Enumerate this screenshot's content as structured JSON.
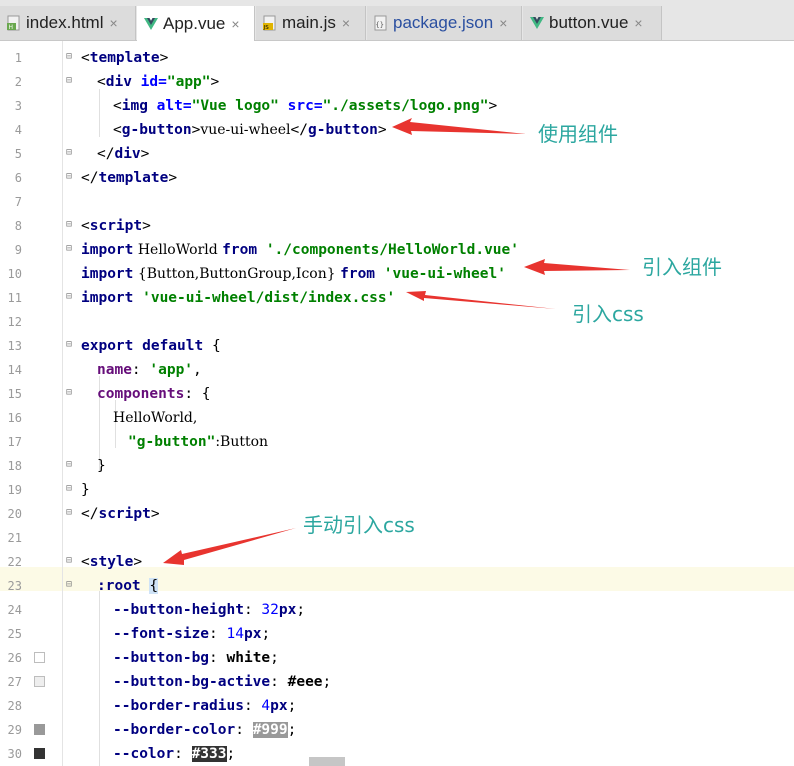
{
  "tabs": [
    {
      "label": "index.html",
      "close": "×",
      "icon": "html-file-icon"
    },
    {
      "label": "App.vue",
      "close": "×",
      "icon": "vue-file-icon"
    },
    {
      "label": "main.js",
      "close": "×",
      "icon": "js-file-icon"
    },
    {
      "label": "package.json",
      "close": "×",
      "icon": "json-file-icon"
    },
    {
      "label": "button.vue",
      "close": "×",
      "icon": "vue-file-icon"
    }
  ],
  "annotations": {
    "use_component": "使用组件",
    "import_component": "引入组件",
    "import_css": "引入css",
    "manual_css": "手动引入css"
  },
  "colors": {
    "accent": "#2ca7a0",
    "arrow": "#e8342f",
    "swatch_white": "#ffffff",
    "swatch_eee": "#eeeeee",
    "swatch_999": "#999999",
    "swatch_333": "#333333"
  },
  "code": {
    "line_numbers": [
      "1",
      "2",
      "3",
      "4",
      "5",
      "6",
      "7",
      "8",
      "9",
      "10",
      "11",
      "12",
      "13",
      "14",
      "15",
      "16",
      "17",
      "18",
      "19",
      "20",
      "21",
      "22",
      "23",
      "24",
      "25",
      "26",
      "27",
      "28",
      "29",
      "30"
    ],
    "l1": {
      "lt": "<",
      "tag": "template",
      "gt": ">"
    },
    "l2": {
      "lt": "<",
      "tag": "div",
      "attr": " id=",
      "val": "\"app\"",
      "gt": ">"
    },
    "l3": {
      "lt": "<",
      "tag": "img",
      "attr1": " alt=",
      "val1": "\"Vue logo\"",
      "attr2": " src=",
      "val2": "\"./assets/logo.png\"",
      "gt": ">"
    },
    "l4": {
      "lt": "<",
      "tag": "g-button",
      "gt": ">",
      "text": "vue-ui-wheel",
      "lt2": "</",
      "tag2": "g-button",
      "gt2": ">"
    },
    "l5": {
      "lt": "</",
      "tag": "div",
      "gt": ">"
    },
    "l6": {
      "lt": "</",
      "tag": "template",
      "gt": ">"
    },
    "l8": {
      "lt": "<",
      "tag": "script",
      "gt": ">"
    },
    "l9": {
      "kw1": "import",
      "name": " HelloWorld ",
      "kw2": "from",
      "str": " './components/HelloWorld.vue'"
    },
    "l10": {
      "kw1": "import",
      "name": " {Button,ButtonGroup,Icon} ",
      "kw2": "from",
      "str": " 'vue-ui-wheel'"
    },
    "l11": {
      "kw1": "import",
      "str": " 'vue-ui-wheel/dist/index.css'"
    },
    "l13": {
      "kw1": "export",
      "kw2": " default",
      "rest": " {"
    },
    "l14": {
      "prop": "name",
      "colon": ": ",
      "str": "'app'",
      "comma": ","
    },
    "l15": {
      "prop": "components",
      "rest": ": {"
    },
    "l16": {
      "text": "HelloWorld,"
    },
    "l17": {
      "str": "\"g-button\"",
      "rest": ":Button"
    },
    "l18": {
      "text": "}"
    },
    "l19": {
      "text": "}"
    },
    "l20": {
      "lt": "</",
      "tag": "script",
      "gt": ">"
    },
    "l22": {
      "lt": "<",
      "tag": "style",
      "gt": ">"
    },
    "l23": {
      "sel": ":root ",
      "brace": "{"
    },
    "l24": {
      "prop": "--button-height",
      "colon": ": ",
      "num": "32",
      "unit": "px",
      "semi": ";"
    },
    "l25": {
      "prop": "--font-size",
      "colon": ": ",
      "num": "14",
      "unit": "px",
      "semi": ";"
    },
    "l26": {
      "prop": "--button-bg",
      "colon": ": ",
      "val": "white",
      "semi": ";"
    },
    "l27": {
      "prop": "--button-bg-active",
      "colon": ": ",
      "val": "#eee",
      "semi": ";"
    },
    "l28": {
      "prop": "--border-radius",
      "colon": ": ",
      "num": "4",
      "unit": "px",
      "semi": ";"
    },
    "l29": {
      "prop": "--border-color",
      "colon": ": ",
      "val": "#999",
      "semi": ";"
    },
    "l30": {
      "prop": "--color",
      "colon": ": ",
      "val": "#333",
      "semi": ";"
    }
  }
}
